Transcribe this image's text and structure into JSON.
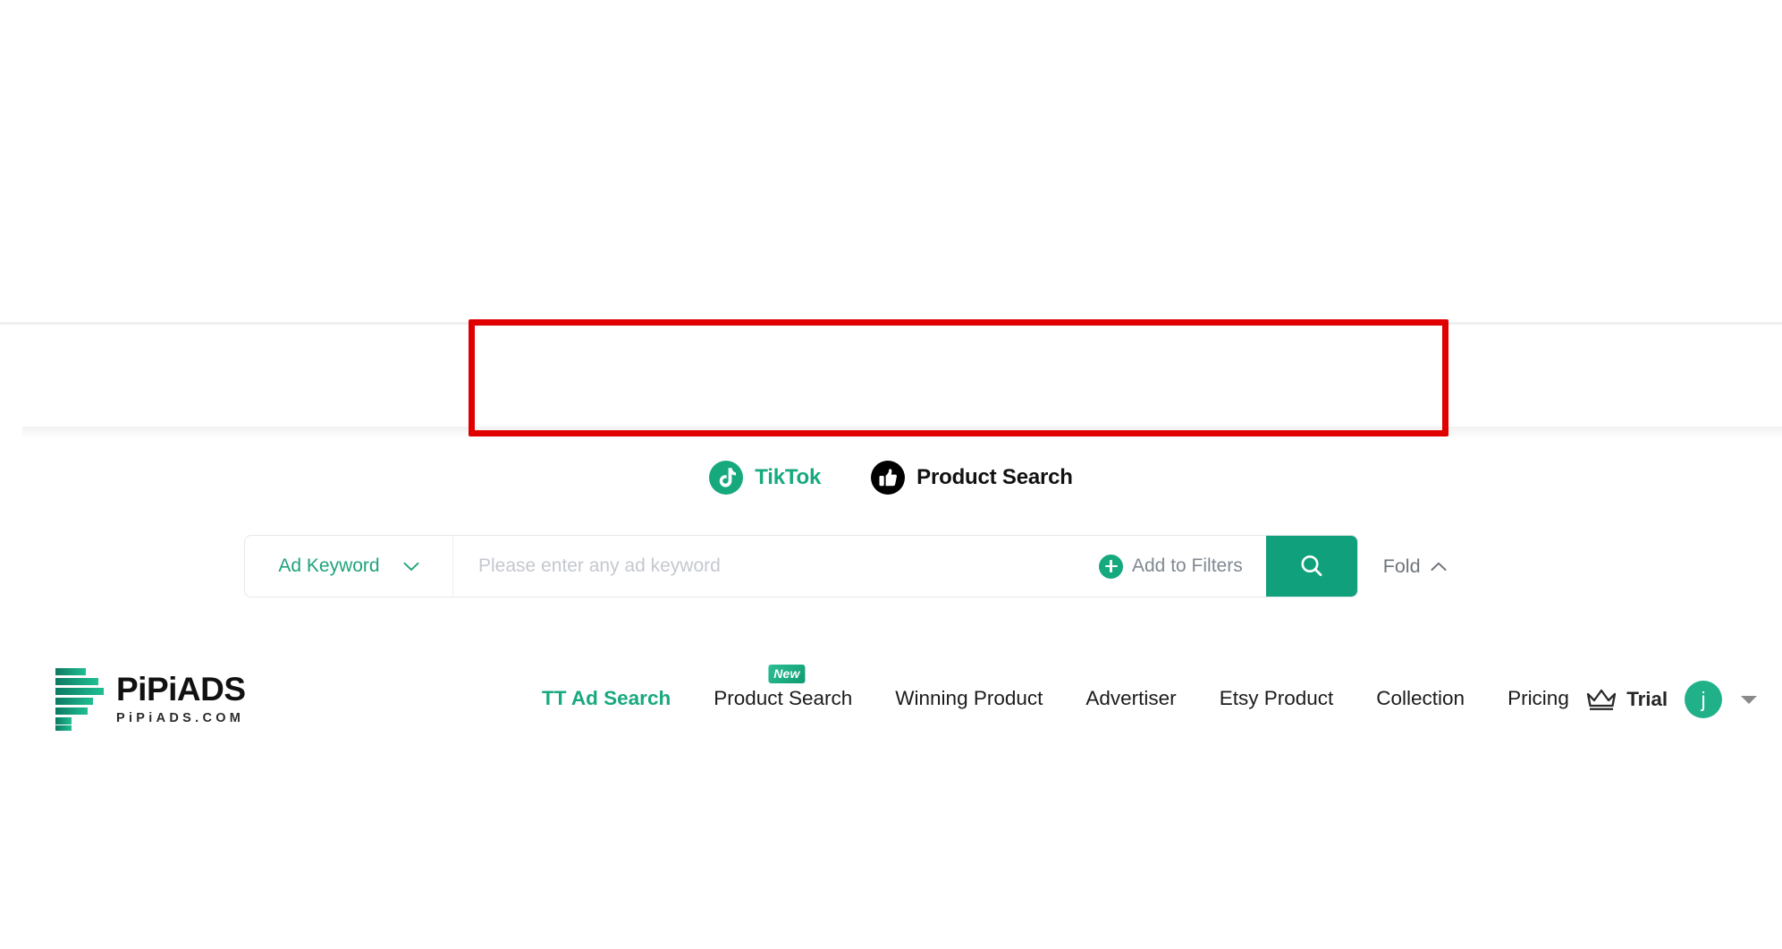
{
  "brand": {
    "name": "PiPiADS",
    "domain": "PiPiADS.COM",
    "logo_icon": "bars-logo-icon",
    "accent_color": "#17a97e"
  },
  "header": {
    "nav_items": [
      {
        "label": "TT Ad Search",
        "active": true,
        "badge": null
      },
      {
        "label": "Product Search",
        "active": false,
        "badge": "New"
      },
      {
        "label": "Winning Product",
        "active": false,
        "badge": null
      },
      {
        "label": "Advertiser",
        "active": false,
        "badge": null
      },
      {
        "label": "Etsy Product",
        "active": false,
        "badge": null
      },
      {
        "label": "Collection",
        "active": false,
        "badge": null
      },
      {
        "label": "Pricing",
        "active": false,
        "badge": null
      }
    ],
    "trial": {
      "label": "Trial",
      "icon": "crown-icon"
    },
    "account": {
      "avatar_initial": "j",
      "avatar_color": "#21b188",
      "caret_icon": "chevron-down-icon"
    }
  },
  "annotation": {
    "type": "red-highlight-box",
    "color": "#e00000",
    "covers": "main navigation menu"
  },
  "source_tabs": [
    {
      "label": "TikTok",
      "icon": "tiktok-note-icon",
      "active": true,
      "color": "#17a97e"
    },
    {
      "label": "Product Search",
      "icon": "thumbs-up-icon",
      "active": false,
      "color": "#111111"
    }
  ],
  "search": {
    "keyword_type": "Ad Keyword",
    "keyword_type_caret": "chevron-down-icon",
    "placeholder": "Please enter any ad keyword",
    "value": "",
    "add_to_filters": "Add to Filters",
    "add_to_filters_icon": "plus-circle-icon",
    "submit_icon": "search-icon",
    "submit_color": "#10a17c",
    "fold_label": "Fold",
    "fold_icon": "chevron-up-icon"
  }
}
